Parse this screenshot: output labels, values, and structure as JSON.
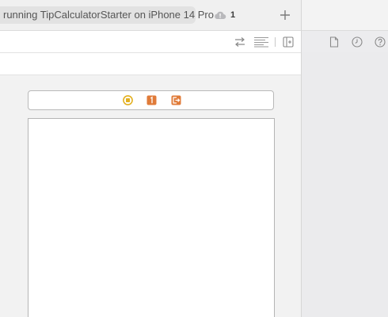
{
  "toolbar": {
    "activity_status": "running TipCalculatorStarter on iPhone 14 Pro",
    "issue_count": "1"
  },
  "icons": {
    "issue": "cloud-warning-icon",
    "add": "plus-icon",
    "related": "swap-arrows-icon",
    "minimap": "editor-options-icon",
    "split": "add-editor-icon",
    "file_inspector": "document-icon",
    "history_inspector": "clock-icon",
    "help_inspector": "question-icon",
    "dock_first": "view-controller-icon",
    "dock_first_responder": "first-responder-icon",
    "dock_exit": "exit-icon"
  },
  "colors": {
    "view_controller": "#e3b020",
    "first_responder": "#e07b39",
    "exit": "#e07b39"
  }
}
